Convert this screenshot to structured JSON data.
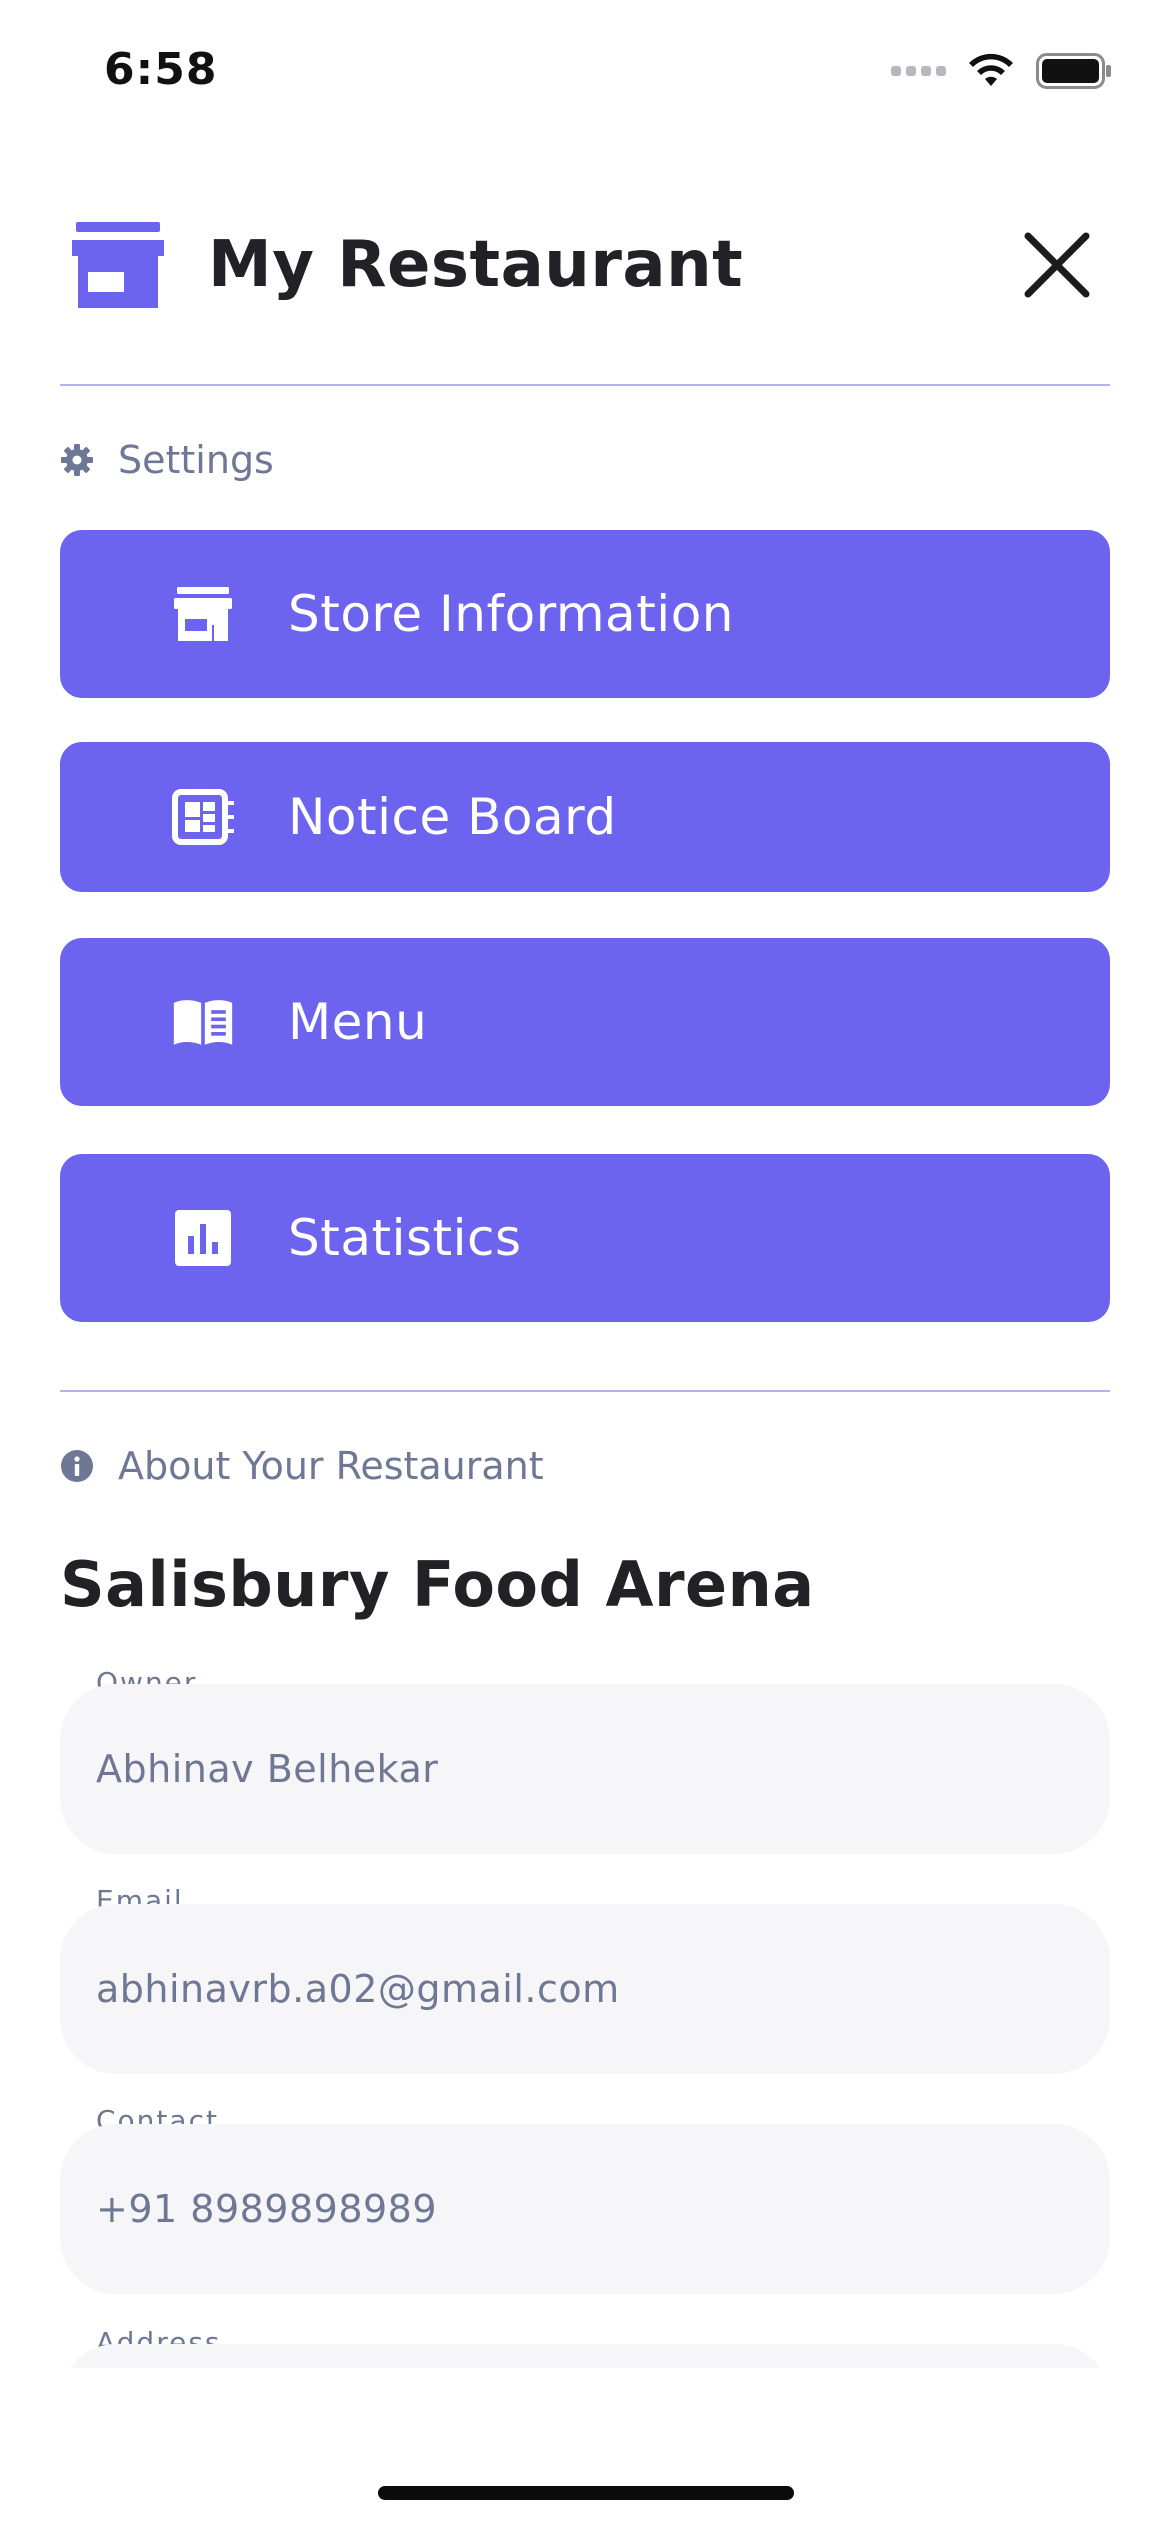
{
  "status_bar": {
    "time": "6:58"
  },
  "header": {
    "title": "My Restaurant"
  },
  "settings_section": {
    "label": "Settings"
  },
  "menu": [
    {
      "label": "Store Information",
      "icon": "store-icon"
    },
    {
      "label": "Notice Board",
      "icon": "notice-board-icon"
    },
    {
      "label": "Menu",
      "icon": "book-icon"
    },
    {
      "label": "Statistics",
      "icon": "chart-icon"
    }
  ],
  "about_section": {
    "label": "About Your Restaurant"
  },
  "restaurant": {
    "name": "Salisbury Food Arena",
    "fields": [
      {
        "label": "Owner",
        "value": "Abhinav Belhekar"
      },
      {
        "label": "Email",
        "value": "abhinavrb.a02@gmail.com"
      },
      {
        "label": "Contact",
        "value": "+91 8989898989"
      },
      {
        "label": "Address",
        "value": ""
      }
    ]
  },
  "colors": {
    "accent": "#6c63ef",
    "muted_text": "#6e7895",
    "field_bg": "#f6f6f8"
  }
}
